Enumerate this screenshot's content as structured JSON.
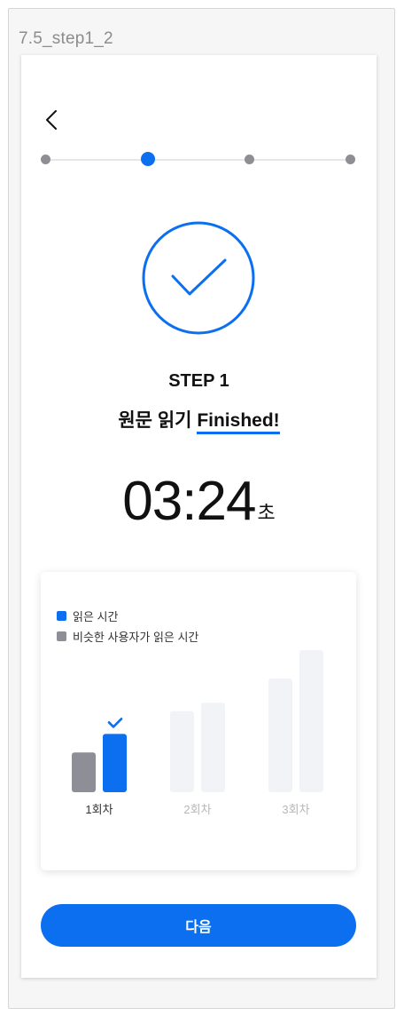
{
  "frame": {
    "label": "7.5_step1_2"
  },
  "header": {
    "back_icon": "chevron-left-icon"
  },
  "stepper": {
    "total": 4,
    "current": 2
  },
  "result": {
    "step_title": "STEP 1",
    "status_prefix": "원문 읽기",
    "status_word": "Finished!",
    "timer": "03:24",
    "timer_unit": "초"
  },
  "chart_data": {
    "type": "bar",
    "categories": [
      "1회차",
      "2회차",
      "3회차"
    ],
    "series": [
      {
        "name": "비슷한 사용자가 읽은 시간",
        "values": [
          0.28,
          0.57,
          0.8
        ],
        "color": "#8e8e96"
      },
      {
        "name": "읽은 시간",
        "values": [
          0.41,
          0.63,
          1.0
        ],
        "color": "#0b6ff0"
      }
    ],
    "completed_rounds": 1,
    "future_color": "#f2f3f7",
    "legend": [
      "읽은 시간",
      "비슷한 사용자가 읽은 시간"
    ],
    "legend_position": "top-left",
    "ylim": [
      0,
      1
    ]
  },
  "next_button": {
    "label": "다음"
  },
  "colors": {
    "accent": "#0b6ff0",
    "gray": "#8e8e96",
    "inactive_label": "#b6b6bc"
  }
}
